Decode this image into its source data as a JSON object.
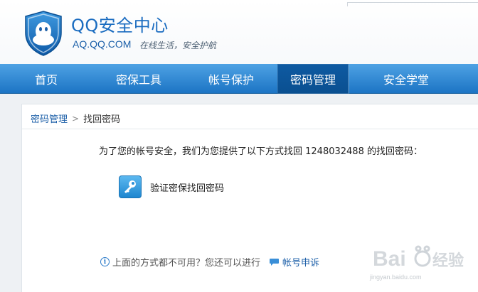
{
  "brand": {
    "title": "QQ安全中心",
    "domain": "AQ.QQ.COM",
    "slogan": "在线生活，安全护航"
  },
  "nav": {
    "items": [
      {
        "label": "首页",
        "active": false
      },
      {
        "label": "密保工具",
        "active": false
      },
      {
        "label": "帐号保护",
        "active": false
      },
      {
        "label": "密码管理",
        "active": true
      },
      {
        "label": "安全学堂",
        "active": false
      }
    ]
  },
  "breadcrumb": {
    "parent": "密码管理",
    "separator": ">",
    "current": "找回密码"
  },
  "content": {
    "intro": "为了您的帐号安全，我们为您提供了以下方式找回 1248032488 的找回密码：",
    "option_label": "验证密保找回密码",
    "fallback_text": "上面的方式都不可用？您还可以进行",
    "appeal_link": "帐号申诉"
  },
  "watermark": {
    "text": "jingyan.baidu.com"
  },
  "colors": {
    "nav_top": "#4ea2e4",
    "nav_bottom": "#1c74c4",
    "nav_active": "#0e5aa2",
    "brand_blue": "#1a6cc0",
    "link": "#1c5fa8"
  },
  "icons": {
    "shield": "qq-shield-logo",
    "key": "key-icon",
    "info": "info-icon",
    "chat": "chat-bubble-icon"
  }
}
